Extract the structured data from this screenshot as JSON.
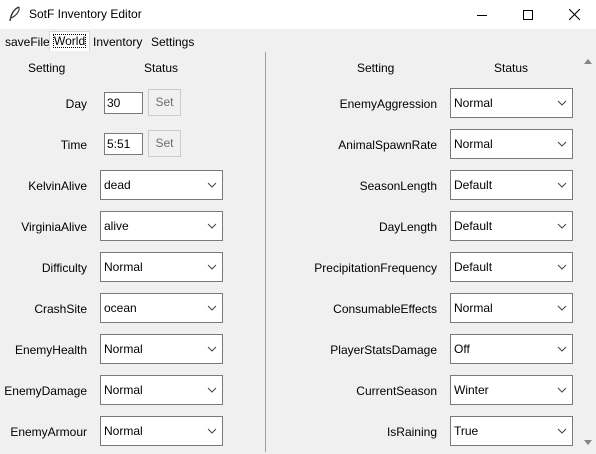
{
  "window": {
    "title": "SotF Inventory Editor",
    "icon": "feather-icon",
    "controls": [
      "minimize-icon",
      "maximize-icon",
      "close-icon"
    ]
  },
  "tabs": [
    {
      "label": "saveFile",
      "active": false
    },
    {
      "label": "World",
      "active": true
    },
    {
      "label": "Inventory",
      "active": false
    },
    {
      "label": "Settings",
      "active": false
    }
  ],
  "left": {
    "header_setting": "Setting",
    "header_status": "Status",
    "day": {
      "label": "Day",
      "value": "30",
      "button": "Set"
    },
    "time": {
      "label": "Time",
      "value": "5:51",
      "button": "Set"
    },
    "selects": [
      {
        "label": "KelvinAlive",
        "value": "dead"
      },
      {
        "label": "VirginiaAlive",
        "value": "alive"
      },
      {
        "label": "Difficulty",
        "value": "Normal"
      },
      {
        "label": "CrashSite",
        "value": "ocean"
      },
      {
        "label": "EnemyHealth",
        "value": "Normal"
      },
      {
        "label": "EnemyDamage",
        "value": "Normal"
      },
      {
        "label": "EnemyArmour",
        "value": "Normal"
      }
    ]
  },
  "right": {
    "header_setting": "Setting",
    "header_status": "Status",
    "selects": [
      {
        "label": "EnemyAggression",
        "value": "Normal"
      },
      {
        "label": "AnimalSpawnRate",
        "value": "Normal"
      },
      {
        "label": "SeasonLength",
        "value": "Default"
      },
      {
        "label": "DayLength",
        "value": "Default"
      },
      {
        "label": "PrecipitationFrequency",
        "value": "Default"
      },
      {
        "label": "ConsumableEffects",
        "value": "Normal"
      },
      {
        "label": "PlayerStatsDamage",
        "value": "Off"
      },
      {
        "label": "CurrentSeason",
        "value": "Winter"
      },
      {
        "label": "IsRaining",
        "value": "True"
      }
    ]
  }
}
